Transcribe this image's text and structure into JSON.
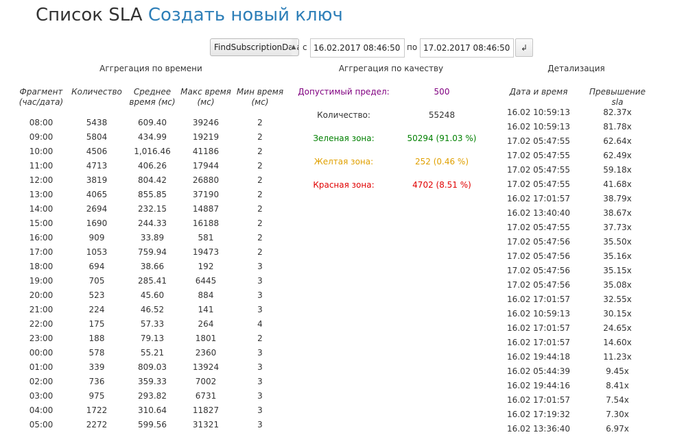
{
  "header": {
    "title": "Список SLA",
    "create_link": "Создать новый ключ"
  },
  "filters": {
    "method": "FindSubscriptionData",
    "from_label": "с",
    "from_value": "16.02.2017 08:46:50",
    "to_label": "по",
    "to_value": "17.02.2017 08:46:50",
    "submit_icon": "enter-icon",
    "submit_glyph": "↲"
  },
  "time_aggregation": {
    "heading": "Аггрегация по времени",
    "columns": [
      "Фрагмент (час/дата)",
      "Количество",
      "Среднее время (мс)",
      "Макс время (мс)",
      "Мин время (мс)"
    ],
    "rows": [
      [
        "08:00",
        "5438",
        "609.40",
        "39246",
        "2"
      ],
      [
        "09:00",
        "5804",
        "434.99",
        "19219",
        "2"
      ],
      [
        "10:00",
        "4506",
        "1,016.46",
        "41186",
        "2"
      ],
      [
        "11:00",
        "4713",
        "406.26",
        "17944",
        "2"
      ],
      [
        "12:00",
        "3819",
        "804.42",
        "26880",
        "2"
      ],
      [
        "13:00",
        "4065",
        "855.85",
        "37190",
        "2"
      ],
      [
        "14:00",
        "2694",
        "232.15",
        "14887",
        "2"
      ],
      [
        "15:00",
        "1690",
        "244.33",
        "16188",
        "2"
      ],
      [
        "16:00",
        "909",
        "33.89",
        "581",
        "2"
      ],
      [
        "17:00",
        "1053",
        "759.94",
        "19473",
        "2"
      ],
      [
        "18:00",
        "694",
        "38.66",
        "192",
        "3"
      ],
      [
        "19:00",
        "705",
        "285.41",
        "6445",
        "3"
      ],
      [
        "20:00",
        "523",
        "45.60",
        "884",
        "3"
      ],
      [
        "21:00",
        "224",
        "46.52",
        "141",
        "3"
      ],
      [
        "22:00",
        "175",
        "57.33",
        "264",
        "4"
      ],
      [
        "23:00",
        "188",
        "79.13",
        "1801",
        "2"
      ],
      [
        "00:00",
        "578",
        "55.21",
        "2360",
        "3"
      ],
      [
        "01:00",
        "339",
        "809.03",
        "13924",
        "3"
      ],
      [
        "02:00",
        "736",
        "359.33",
        "7002",
        "3"
      ],
      [
        "03:00",
        "975",
        "293.82",
        "6731",
        "3"
      ],
      [
        "04:00",
        "1722",
        "310.64",
        "11827",
        "3"
      ],
      [
        "05:00",
        "2272",
        "599.56",
        "31321",
        "3"
      ]
    ]
  },
  "quality_aggregation": {
    "heading": "Аггрегация по качеству",
    "limit_label": "Допустимый предел:",
    "limit_value": "500",
    "count_label": "Количество:",
    "count_value": "55248",
    "green_label": "Зеленая зона:",
    "green_value": "50294 (91.03 %)",
    "yellow_label": "Желтая зона:",
    "yellow_value": "252 (0.46 %)",
    "red_label": "Красная зона:",
    "red_value": "4702 (8.51 %)",
    "colors": {
      "limit": "#800080",
      "green": "#008000",
      "yellow": "#e0a000",
      "red": "#e00000"
    }
  },
  "details": {
    "heading": "Детализация",
    "columns": [
      "Дата и время",
      "Превышение sla"
    ],
    "rows": [
      [
        "16.02 10:59:13",
        "82.37x"
      ],
      [
        "16.02 10:59:13",
        "81.78x"
      ],
      [
        "17.02 05:47:55",
        "62.64x"
      ],
      [
        "17.02 05:47:55",
        "62.49x"
      ],
      [
        "17.02 05:47:55",
        "59.18x"
      ],
      [
        "17.02 05:47:55",
        "41.68x"
      ],
      [
        "16.02 17:01:57",
        "38.79x"
      ],
      [
        "16.02 13:40:40",
        "38.67x"
      ],
      [
        "17.02 05:47:55",
        "37.73x"
      ],
      [
        "17.02 05:47:56",
        "35.50x"
      ],
      [
        "17.02 05:47:56",
        "35.16x"
      ],
      [
        "17.02 05:47:56",
        "35.15x"
      ],
      [
        "17.02 05:47:56",
        "35.08x"
      ],
      [
        "16.02 17:01:57",
        "32.55x"
      ],
      [
        "16.02 10:59:13",
        "30.15x"
      ],
      [
        "16.02 17:01:57",
        "24.65x"
      ],
      [
        "16.02 17:01:57",
        "14.60x"
      ],
      [
        "16.02 19:44:18",
        "11.23x"
      ],
      [
        "16.02 05:44:39",
        "9.45x"
      ],
      [
        "16.02 19:44:16",
        "8.41x"
      ],
      [
        "16.02 17:01:57",
        "7.54x"
      ],
      [
        "16.02 17:19:32",
        "7.30x"
      ],
      [
        "16.02 13:36:40",
        "6.97x"
      ]
    ]
  }
}
